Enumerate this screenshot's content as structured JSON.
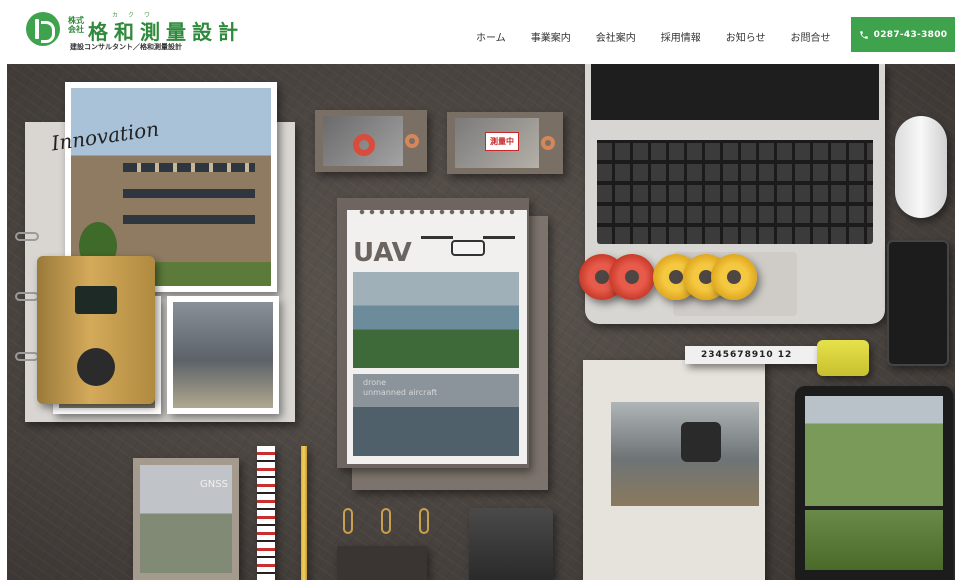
{
  "header": {
    "logo": {
      "corp_label": "株式会社",
      "ruby": "カクワ",
      "name": "格和測量設計",
      "subtitle": "建設コンサルタント／格和測量設計"
    },
    "nav": [
      {
        "label": "ホーム"
      },
      {
        "label": "事業案内"
      },
      {
        "label": "会社案内"
      },
      {
        "label": "採用情報"
      },
      {
        "label": "お知らせ"
      },
      {
        "label": "お問合せ"
      }
    ],
    "phone": {
      "number": "0287-43-3800",
      "icon": "phone-icon"
    }
  },
  "hero": {
    "innovation_text": "Innovation",
    "survey_sign": "測量中",
    "uav_title": "UAV",
    "uav_caption_line1": "drone",
    "uav_caption_line2": "unmanned aircraft",
    "measure_tape": "2345678910 12",
    "gnss_label": "GNSS"
  },
  "colors": {
    "brand_green": "#3fa34d",
    "hero_background": "#4a4440"
  }
}
